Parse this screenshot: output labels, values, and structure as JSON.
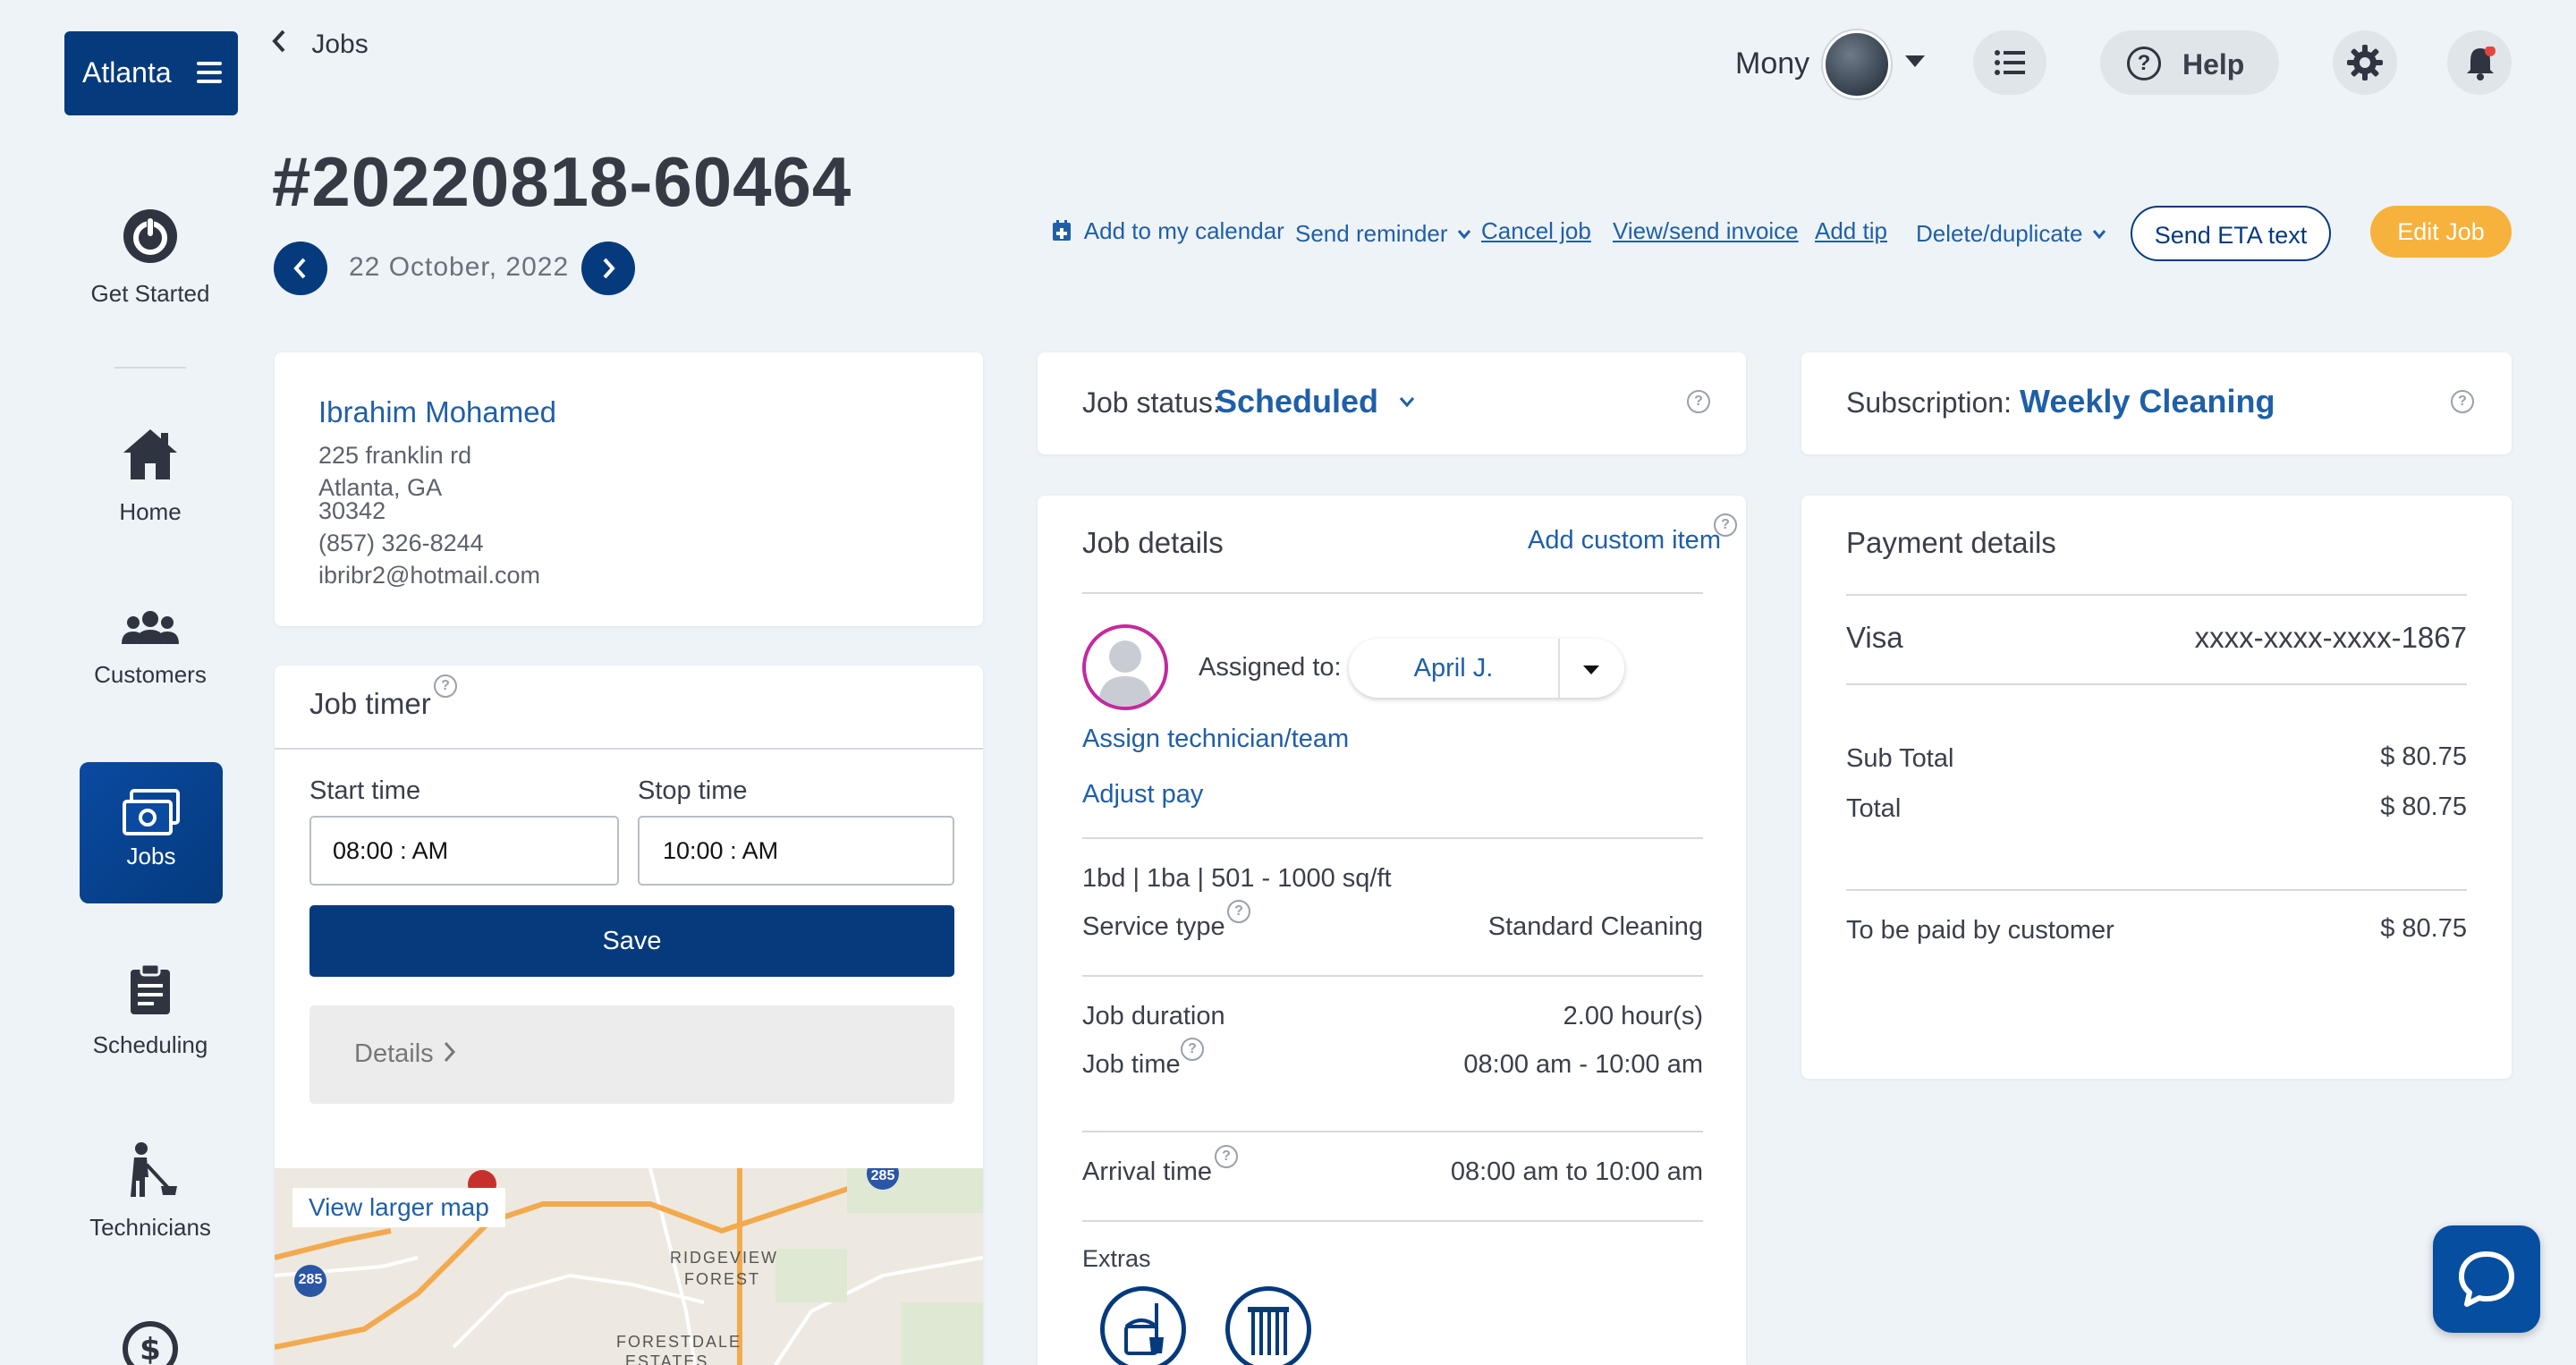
{
  "sidebar": {
    "brand": "Atlanta",
    "items": [
      {
        "label": "Get Started",
        "icon": "power-icon"
      },
      {
        "label": "Home",
        "icon": "home-icon"
      },
      {
        "label": "Customers",
        "icon": "users-icon"
      },
      {
        "label": "Jobs",
        "icon": "jobs-icon",
        "active": true
      },
      {
        "label": "Scheduling",
        "icon": "clipboard-icon"
      },
      {
        "label": "Technicians",
        "icon": "cleaner-icon"
      },
      {
        "label": "",
        "icon": "dollar-icon"
      }
    ]
  },
  "topbar": {
    "back_label": "Jobs",
    "user_name": "Mony",
    "help_label": "Help"
  },
  "job": {
    "number": "#20220818-60464",
    "date": "22 October, 2022"
  },
  "actions": {
    "add_calendar": "Add to my calendar",
    "send_reminder": "Send reminder",
    "cancel_job": "Cancel job",
    "view_invoice": "View/send invoice",
    "add_tip": "Add tip",
    "delete_duplicate": "Delete/duplicate",
    "send_eta": "Send ETA text",
    "edit_job": "Edit Job"
  },
  "customer": {
    "name": "Ibrahim Mohamed",
    "street": "225 franklin rd",
    "city": "Atlanta, GA",
    "zip": "30342",
    "phone": "(857) 326-8244",
    "email": "ibribr2@hotmail.com"
  },
  "timer": {
    "title": "Job timer",
    "start_label": "Start time",
    "stop_label": "Stop time",
    "start_value": "08:00 : AM",
    "stop_value": "10:00 : AM",
    "save_label": "Save",
    "details_label": "Details"
  },
  "map": {
    "link_label": "View larger map",
    "places": [
      "RIDGEVIEW",
      "FOREST",
      "FORESTDALE",
      "ESTATES"
    ],
    "shields": [
      "285",
      "285"
    ]
  },
  "status": {
    "label": "Job status:",
    "value": "Scheduled"
  },
  "details": {
    "title": "Job details",
    "add_custom": "Add custom item",
    "assigned_label": "Assigned to:",
    "assigned_value": "April J.",
    "assign_link": "Assign technician/team",
    "adjust_pay": "Adjust pay",
    "property": "1bd | 1ba | 501 - 1000 sq/ft",
    "service_type_label": "Service type",
    "service_type_value": "Standard Cleaning",
    "duration_label": "Job duration",
    "duration_value": "2.00 hour(s)",
    "job_time_label": "Job time",
    "job_time_value": "08:00 am - 10:00 am",
    "arrival_label": "Arrival time",
    "arrival_value": "08:00 am to 10:00 am",
    "extras_label": "Extras"
  },
  "subscription": {
    "label": "Subscription:",
    "value": "Weekly Cleaning"
  },
  "payment": {
    "title": "Payment details",
    "card_type": "Visa",
    "card_number": "xxxx-xxxx-xxxx-1867",
    "subtotal_label": "Sub Total",
    "subtotal_value": "$ 80.75",
    "total_label": "Total",
    "total_value": "$ 80.75",
    "customer_pay_label": "To be paid by customer",
    "customer_pay_value": "$ 80.75"
  },
  "colors": {
    "navy": "#053a7d",
    "link": "#1f5fa8",
    "edit_button": "#f6b23c",
    "background": "#eef3f8"
  }
}
